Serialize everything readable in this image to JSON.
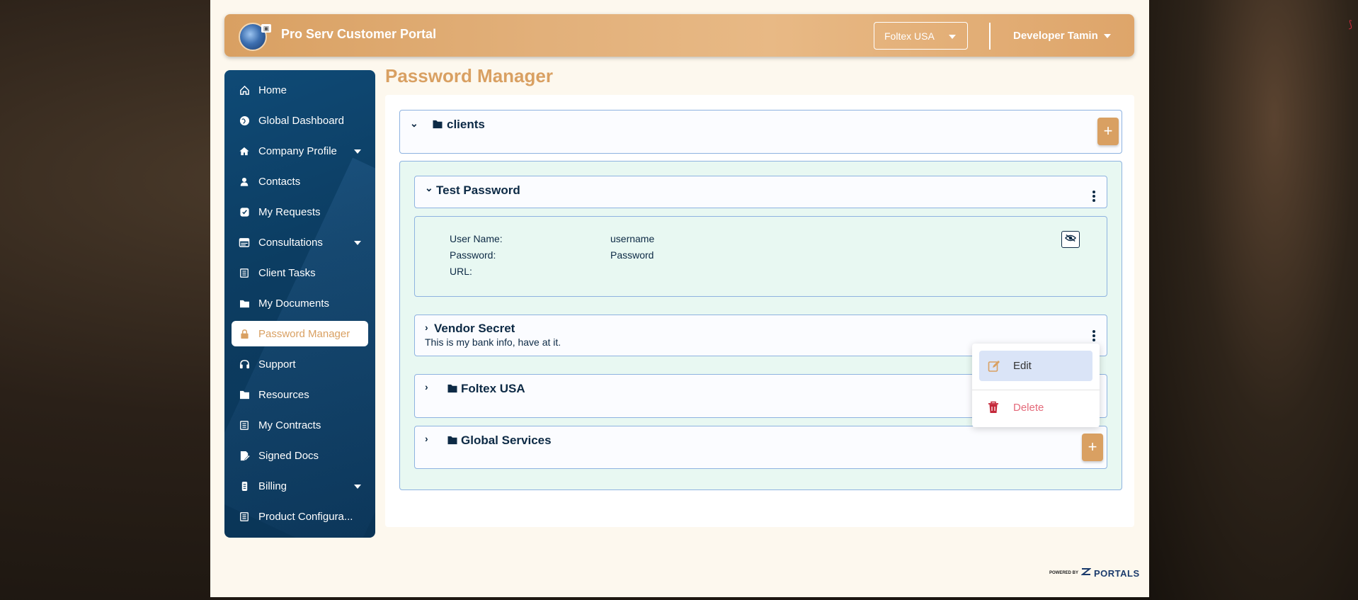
{
  "app": {
    "title": "Pro Serv Customer Portal"
  },
  "header": {
    "company_select": "Foltex USA",
    "user_name": "Developer Tamin"
  },
  "sidebar": {
    "items": [
      {
        "label": "Home",
        "icon": "home-icon"
      },
      {
        "label": "Global Dashboard",
        "icon": "globe-icon"
      },
      {
        "label": "Company Profile",
        "icon": "house-icon",
        "dropdown": true
      },
      {
        "label": "Contacts",
        "icon": "person-icon"
      },
      {
        "label": "My Requests",
        "icon": "request-icon"
      },
      {
        "label": "Consultations",
        "icon": "consultation-icon",
        "dropdown": true
      },
      {
        "label": "Client Tasks",
        "icon": "list-icon"
      },
      {
        "label": "My Documents",
        "icon": "folder-icon"
      },
      {
        "label": "Password Manager",
        "icon": "lock-icon",
        "active": true
      },
      {
        "label": "Support",
        "icon": "headset-icon"
      },
      {
        "label": "Resources",
        "icon": "folder-icon"
      },
      {
        "label": "My Contracts",
        "icon": "list-icon"
      },
      {
        "label": "Signed Docs",
        "icon": "signature-icon"
      },
      {
        "label": "Billing",
        "icon": "money-icon",
        "dropdown": true
      },
      {
        "label": "Product Configura...",
        "icon": "list-icon"
      }
    ]
  },
  "main": {
    "page_title": "Password Manager",
    "root_folder": "clients",
    "entries": [
      {
        "title": "Test Password",
        "fields": [
          {
            "label": "User Name:",
            "value": "username"
          },
          {
            "label": "Password:",
            "value": "Password"
          },
          {
            "label": "URL:",
            "value": ""
          }
        ]
      },
      {
        "title": "Vendor Secret",
        "description": "This is my bank info, have at it."
      }
    ],
    "subfolders": [
      "Foltex USA",
      "Global Services"
    ],
    "context_menu": {
      "edit": "Edit",
      "delete": "Delete"
    },
    "add_symbol": "+"
  },
  "footer": {
    "powered_by": "POWERED BY",
    "brand": "PORTALS"
  },
  "colors": {
    "accent": "#d9a062",
    "sidebar": "#0c3d62",
    "panel": "#e8f8f2",
    "danger": "#e46a7a"
  }
}
